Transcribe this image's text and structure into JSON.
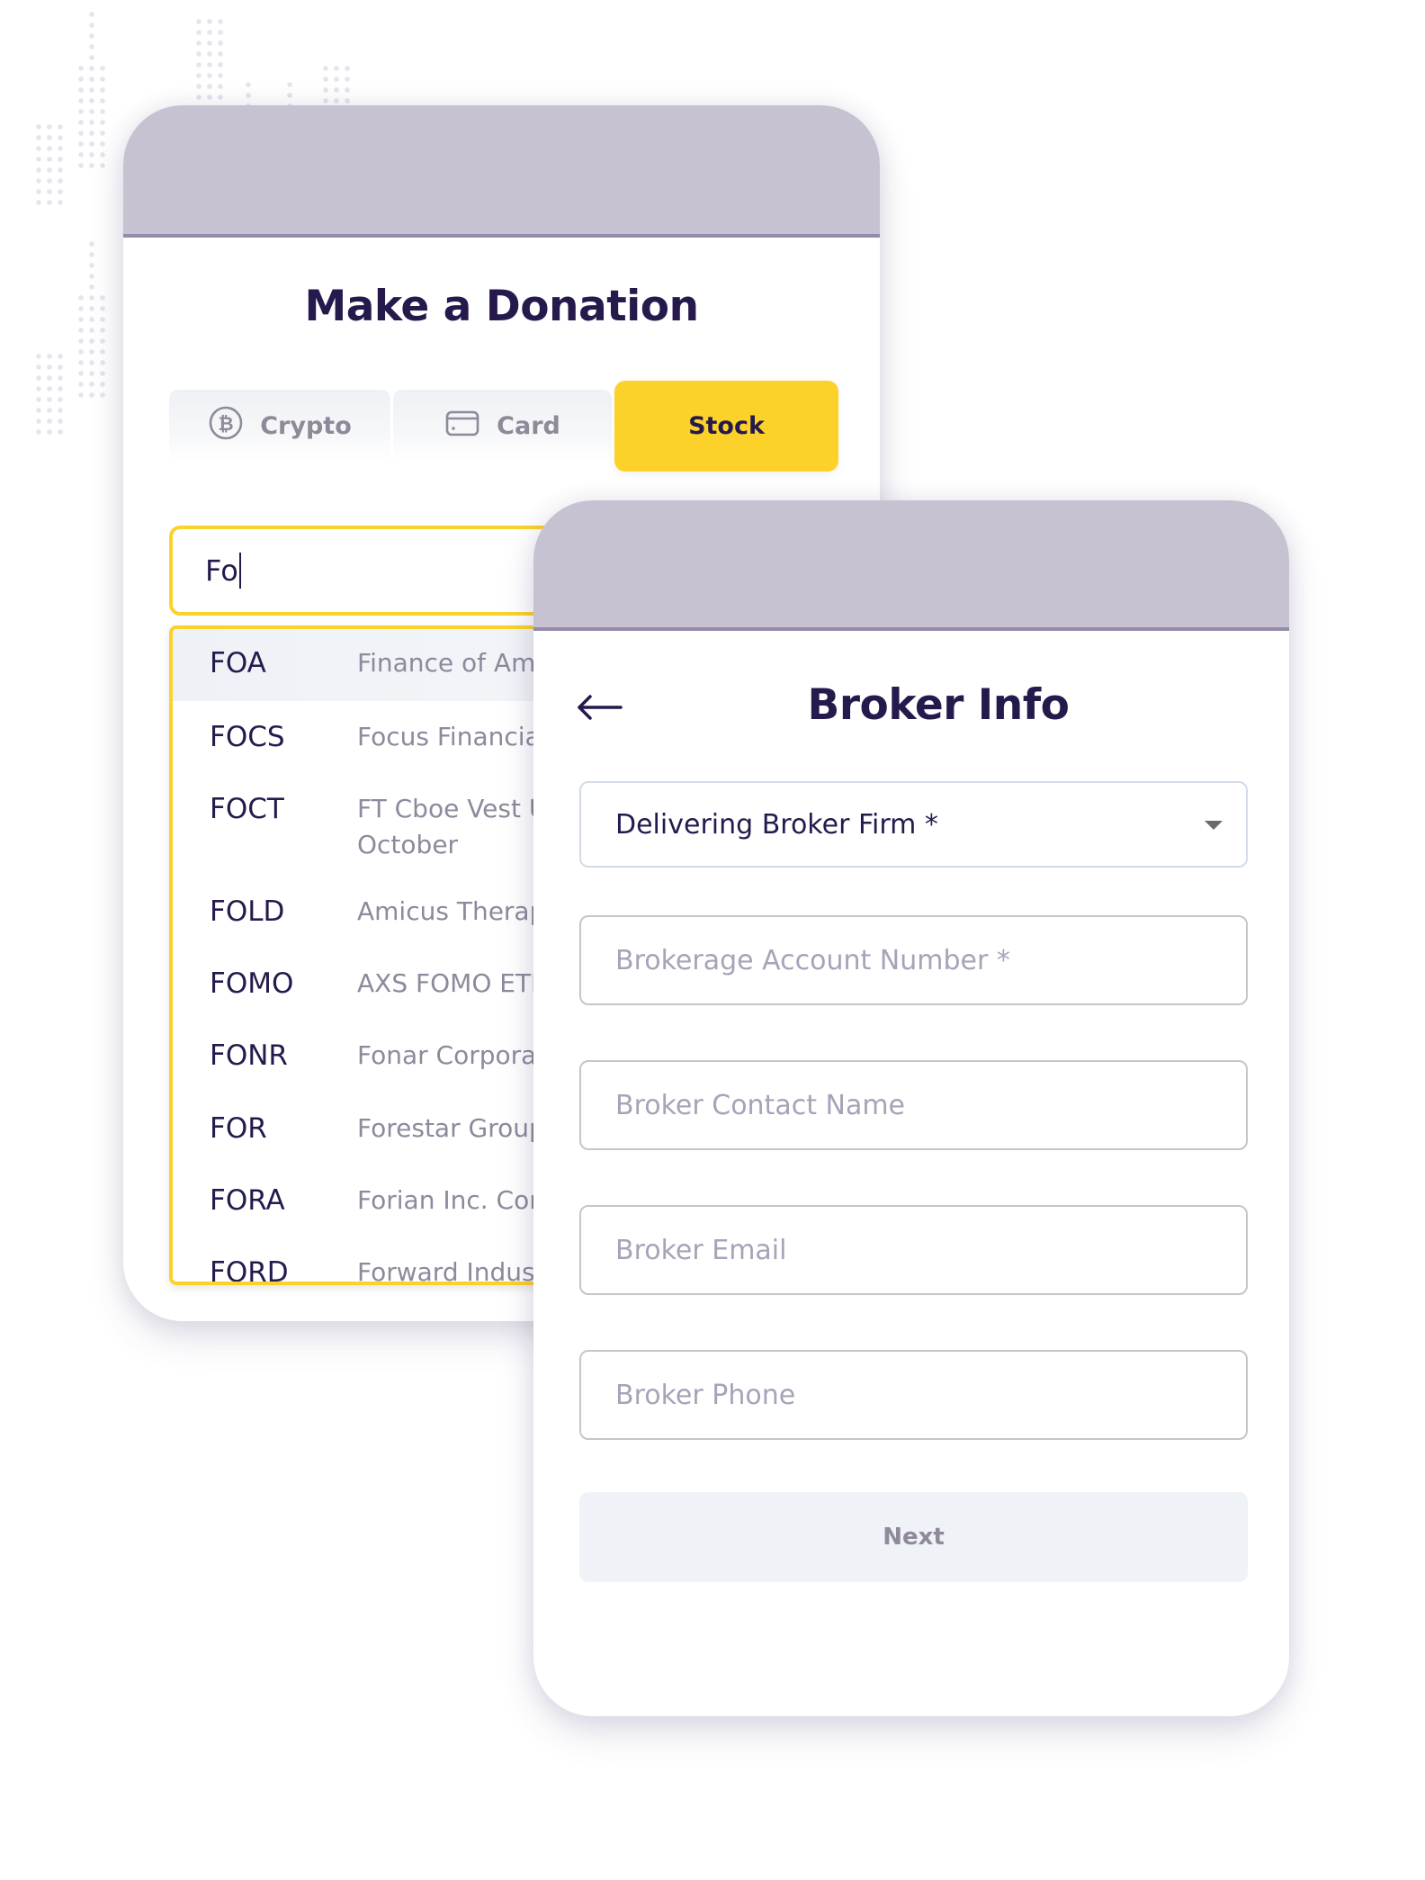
{
  "colors": {
    "accent_yellow": "#FCD22A",
    "header_lavender": "#C7C2D1",
    "header_rule": "#958BA8",
    "title_navy": "#261A4D",
    "muted_text": "#8E8A99",
    "placeholder": "#A7A3B8"
  },
  "donation": {
    "title": "Make a Donation",
    "tabs": [
      {
        "label": "Crypto",
        "icon": "bitcoin-icon",
        "active": false
      },
      {
        "label": "Card",
        "icon": "credit-card-icon",
        "active": false
      },
      {
        "label": "Stock",
        "icon": null,
        "active": true
      }
    ],
    "search": {
      "value": "Fo"
    },
    "results": [
      {
        "ticker": "FOA",
        "name": "Finance of Ame",
        "highlighted": true
      },
      {
        "ticker": "FOCS",
        "name": "Focus Financia"
      },
      {
        "ticker": "FOCT",
        "name": "FT Cboe Vest U\nOctober"
      },
      {
        "ticker": "FOLD",
        "name": "Amicus Therap"
      },
      {
        "ticker": "FOMO",
        "name": "AXS FOMO ETF"
      },
      {
        "ticker": "FONR",
        "name": "Fonar Corporat"
      },
      {
        "ticker": "FOR",
        "name": "Forestar Group"
      },
      {
        "ticker": "FORA",
        "name": "Forian Inc. Cor"
      },
      {
        "ticker": "FORD",
        "name": "Forward Indus"
      }
    ]
  },
  "broker": {
    "title": "Broker Info",
    "back_icon": "arrow-left-icon",
    "firm_select": {
      "value": "Delivering Broker Firm *"
    },
    "fields": {
      "account_number": {
        "placeholder": "Brokerage Account Number *"
      },
      "contact_name": {
        "placeholder": "Broker Contact Name"
      },
      "email": {
        "placeholder": "Broker Email"
      },
      "phone": {
        "placeholder": "Broker Phone"
      }
    },
    "next_label": "Next"
  }
}
